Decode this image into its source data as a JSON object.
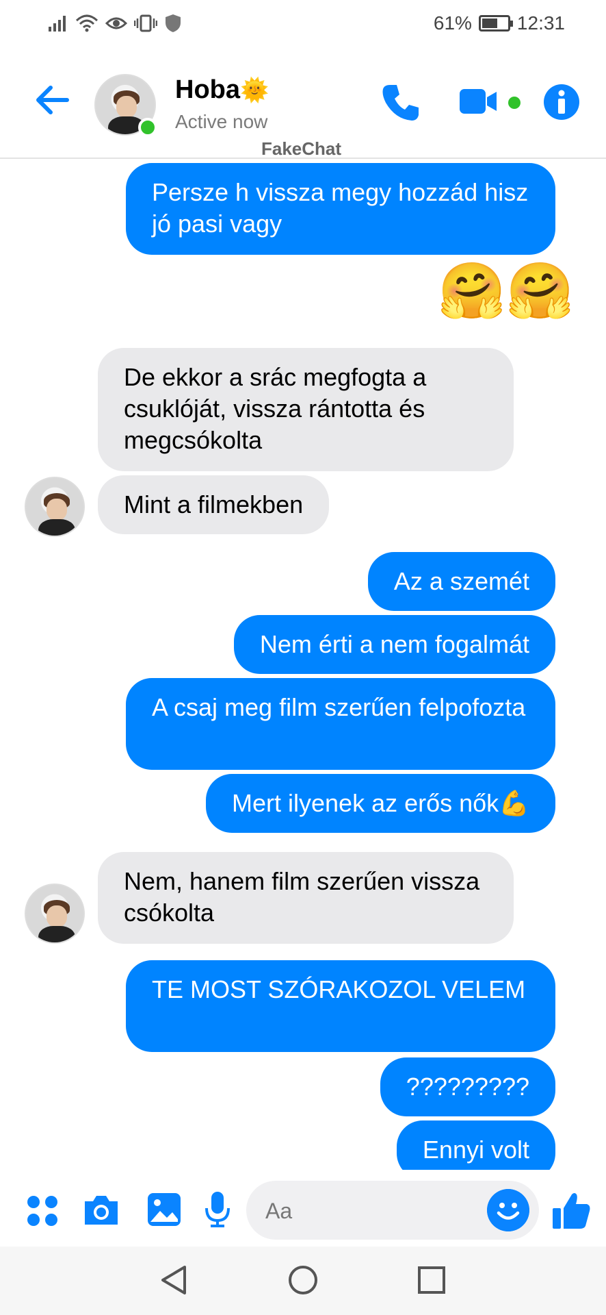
{
  "status_bar": {
    "battery_percent": "61%",
    "battery_level": 0.61,
    "time": "12:31",
    "icons": [
      "signal-icon",
      "wifi-icon",
      "eye-icon",
      "vibrate-icon",
      "shield-icon"
    ]
  },
  "header": {
    "contact_name": "Hoba",
    "name_emoji": "🌞",
    "status": "Active now",
    "watermark": "FakeChat",
    "accent_color": "#0a84ff",
    "online_color": "#31c22b"
  },
  "messages": [
    {
      "side": "out",
      "text": "Persze h vissza megy hozzád hisz jó pasi vagy"
    },
    {
      "side": "out",
      "type": "emoji",
      "text": "🤗🤗"
    },
    {
      "side": "in",
      "text": "De ekkor a srác megfogta a csuklóját, vissza rántotta és megcsókolta"
    },
    {
      "side": "in",
      "text": "Mint a filmekben"
    },
    {
      "side": "out",
      "text": "Az a szemét"
    },
    {
      "side": "out",
      "text": "Nem érti a nem fogalmát"
    },
    {
      "side": "out",
      "text": "A csaj meg film szerűen felpofozta"
    },
    {
      "side": "out",
      "text": "Mert ilyenek az erős nők💪"
    },
    {
      "side": "in",
      "text": "Nem, hanem film szerűen vissza csókolta"
    },
    {
      "side": "out",
      "text": "TE MOST SZÓRAKOZOL VELEM"
    },
    {
      "side": "out",
      "text": "?????????"
    },
    {
      "side": "out",
      "text": "Ennyi volt"
    }
  ],
  "colors": {
    "outgoing_bubble": "#0084ff",
    "incoming_bubble": "#e9e9eb"
  },
  "composer": {
    "placeholder": "Aa"
  }
}
